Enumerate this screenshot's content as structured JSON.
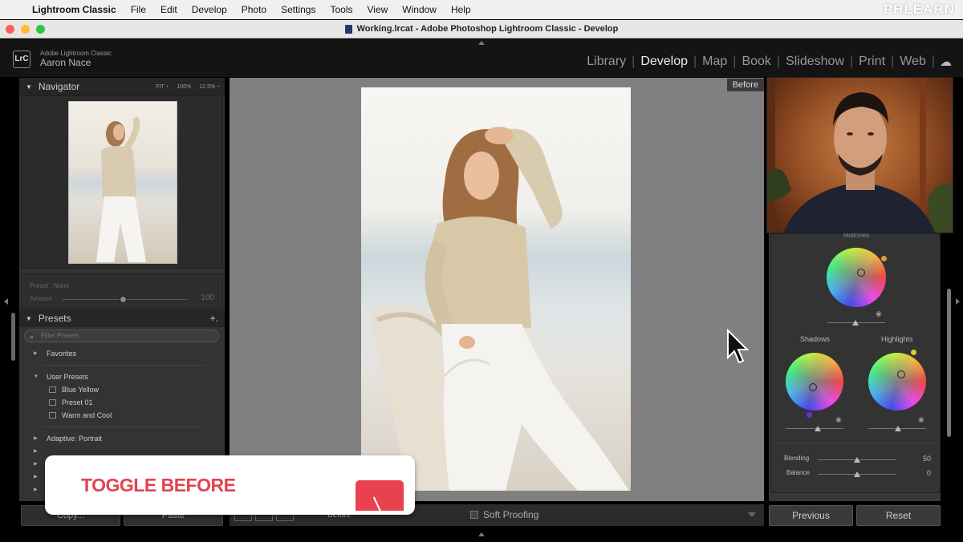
{
  "menubar": {
    "items": [
      "Lightroom Classic",
      "File",
      "Edit",
      "Develop",
      "Photo",
      "Settings",
      "Tools",
      "View",
      "Window",
      "Help"
    ],
    "watermark": "PHLEARN"
  },
  "window": {
    "title": "Working.lrcat - Adobe Photoshop Lightroom Classic - Develop",
    "traffic_colors": [
      "#ff5f57",
      "#febc2e",
      "#28c840"
    ]
  },
  "identity": {
    "badge": "LrC",
    "app": "Adobe Lightroom Classic",
    "user": "Aaron Nace"
  },
  "modules": {
    "items": [
      "Library",
      "Develop",
      "Map",
      "Book",
      "Slideshow",
      "Print",
      "Web"
    ],
    "active": "Develop",
    "cloud_icon": "cloud-icon"
  },
  "navigator": {
    "title": "Navigator",
    "zoom_options": [
      "FIT ÷",
      "100%",
      "12.5% ÷"
    ]
  },
  "preset_amount": {
    "preset_label": "Preset : None",
    "amount_label": "Amount",
    "amount_value": "100"
  },
  "presets": {
    "title": "Presets",
    "add": "+.",
    "filter_placeholder": "Filter Presets",
    "groups": [
      {
        "label": "Favorites",
        "expanded": false
      },
      {
        "label": "User Presets",
        "expanded": true,
        "children": [
          "Blue Yellow",
          "Preset 01",
          "Warm and Cool"
        ]
      },
      {
        "label": "Adaptive: Portrait",
        "expanded": false
      }
    ]
  },
  "left_buttons": {
    "copy": "Copy...",
    "paste": "Paste"
  },
  "center": {
    "before_label": "Before",
    "toolbar_before": "Before",
    "soft_proofing": "Soft Proofing"
  },
  "color_grading": {
    "top_title": "Midtones",
    "shadows": "Shadows",
    "highlights": "Highlights",
    "blending_label": "Blending",
    "blending_value": "50",
    "balance_label": "Balance",
    "balance_value": "0",
    "blending_level": 0.5,
    "balance_level": 0.5
  },
  "right_buttons": {
    "previous": "Previous",
    "reset": "Reset"
  },
  "overlay": {
    "text": "TOGGLE BEFORE",
    "accent": "#e04450"
  }
}
